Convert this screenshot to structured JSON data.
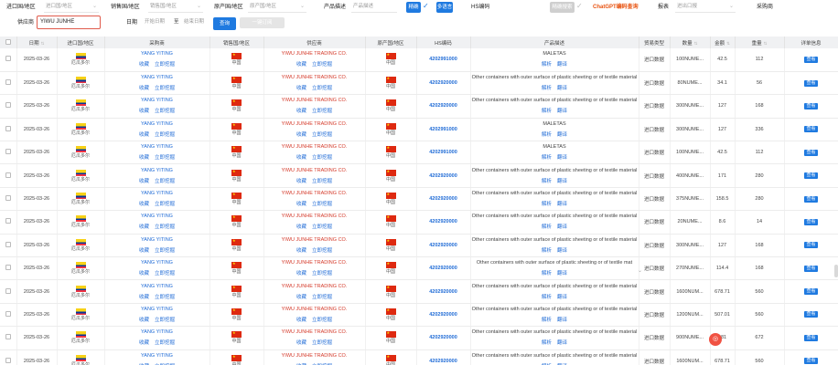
{
  "filters": {
    "import_country_label": "进口国/地区",
    "import_country_placeholder": "进口国/地区",
    "sales_country_label": "销售国/地区",
    "sales_country_placeholder": "销售国/地区",
    "origin_country_label": "原产国/地区",
    "origin_country_placeholder": "原产国/地区",
    "product_desc_label": "产品描述",
    "product_desc_placeholder": "产品描述",
    "exact_button": "精确",
    "multi_button": "多语言",
    "hs_label": "HS编码",
    "hs_action_button": "精确搜索",
    "chatgpt_button": "ChatGPT编码查询",
    "report_label": "报表",
    "report_placeholder": "进出口报",
    "buyer_label": "采购商",
    "supplier_label": "供应商",
    "supplier_value": "YIWU JUNHE",
    "date_label": "日期",
    "start_date_placeholder": "开始日期",
    "date_separator": "至",
    "end_date_placeholder": "结束日期",
    "search_button": "查询",
    "subscribe_button": "一键订阅"
  },
  "table": {
    "headers": {
      "date": "日期",
      "import_country": "进口国/地区",
      "buyer": "采购商",
      "sales_country": "销售国/地区",
      "supplier": "供应商",
      "origin_country": "原产国/地区",
      "hs": "HS编码",
      "desc": "产品描述",
      "trade_type": "贸易类型",
      "quantity": "数量",
      "amount": "金额",
      "weight": "重量",
      "detail": "详单信息"
    },
    "country_ec": "厄瓜多尔",
    "country_cn": "中国",
    "collect_label": "收藏",
    "tracking_label": "立即挖掘",
    "translate_a": "解析",
    "translate_b": "翻译",
    "view_label": "查看",
    "rows": [
      {
        "date": "2025-03-26",
        "buyer": "YANG YITING",
        "supplier": "YIWU JUNHE TRADING CO.",
        "hs": "4202991000",
        "desc": "MALETAS",
        "trade": "进口数据",
        "qty": "100NUME...",
        "amount": "42.5",
        "weight": "112"
      },
      {
        "date": "2025-03-26",
        "buyer": "YANG YITING",
        "supplier": "YIWU JUNHE TRADING CO.",
        "hs": "4202920000",
        "desc": "Other containers with outer surface of plastic sheeting or of textile material",
        "trade": "进口数据",
        "qty": "80NUME...",
        "amount": "34.1",
        "weight": "56"
      },
      {
        "date": "2025-03-26",
        "buyer": "YANG YITING",
        "supplier": "YIWU JUNHE TRADING CO.",
        "hs": "4202920000",
        "desc": "Other containers with outer surface of plastic sheeting or of textile material",
        "trade": "进口数据",
        "qty": "300NUME...",
        "amount": "127",
        "weight": "168"
      },
      {
        "date": "2025-03-26",
        "buyer": "YANG YITING",
        "supplier": "YIWU JUNHE TRADING CO.",
        "hs": "4202991000",
        "desc": "MALETAS",
        "trade": "进口数据",
        "qty": "300NUME...",
        "amount": "127",
        "weight": "336"
      },
      {
        "date": "2025-03-26",
        "buyer": "YANG YITING",
        "supplier": "YIWU JUNHE TRADING CO.",
        "hs": "4202991000",
        "desc": "MALETAS",
        "trade": "进口数据",
        "qty": "100NUME...",
        "amount": "42.5",
        "weight": "112"
      },
      {
        "date": "2025-03-26",
        "buyer": "YANG YITING",
        "supplier": "YIWU JUNHE TRADING CO.",
        "hs": "4202920000",
        "desc": "Other containers with outer surface of plastic sheeting or of textile material",
        "trade": "进口数据",
        "qty": "400NUME...",
        "amount": "171",
        "weight": "280"
      },
      {
        "date": "2025-03-26",
        "buyer": "YANG YITING",
        "supplier": "YIWU JUNHE TRADING CO.",
        "hs": "4202920000",
        "desc": "Other containers with outer surface of plastic sheeting or of textile material",
        "trade": "进口数据",
        "qty": "375NUME...",
        "amount": "158.5",
        "weight": "280"
      },
      {
        "date": "2025-03-26",
        "buyer": "YANG YITING",
        "supplier": "YIWU JUNHE TRADING CO.",
        "hs": "4202920000",
        "desc": "Other containers with outer surface of plastic sheeting or of textile material",
        "trade": "进口数据",
        "qty": "20NUME...",
        "amount": "8.6",
        "weight": "14"
      },
      {
        "date": "2025-03-26",
        "buyer": "YANG YITING",
        "supplier": "YIWU JUNHE TRADING CO.",
        "hs": "4202920000",
        "desc": "Other containers with outer surface of plastic sheeting or of textile material",
        "trade": "进口数据",
        "qty": "300NUME...",
        "amount": "127",
        "weight": "168"
      },
      {
        "date": "2025-03-26",
        "buyer": "YANG YITING",
        "supplier": "YIWU JUNHE TRADING CO.",
        "hs": "4202920000",
        "desc": "Other containers with outer surface of plastic sheeting or of textile mat",
        "trade": "进口数据",
        "qty": "270NUME...",
        "amount": "114.4",
        "weight": "168"
      },
      {
        "date": "2025-03-26",
        "buyer": "YANG YITING",
        "supplier": "YIWU JUNHE TRADING CO.",
        "hs": "4202920000",
        "desc": "Other containers with outer surface of plastic sheeting or of textile material",
        "trade": "进口数据",
        "qty": "1600NUM...",
        "amount": "678.71",
        "weight": "560"
      },
      {
        "date": "2025-03-26",
        "buyer": "YANG YITING",
        "supplier": "YIWU JUNHE TRADING CO.",
        "hs": "4202920000",
        "desc": "Other containers with outer surface of plastic sheeting or of textile material",
        "trade": "进口数据",
        "qty": "1200NUM...",
        "amount": "507.01",
        "weight": "560"
      },
      {
        "date": "2025-03-26",
        "buyer": "YANG YITING",
        "supplier": "YIWU JUNHE TRADING CO.",
        "hs": "4202920000",
        "desc": "Other containers with outer surface of plastic sheeting or of textile material",
        "trade": "进口数据",
        "qty": "900NUME...",
        "amount": "381",
        "weight": "672"
      },
      {
        "date": "2025-03-26",
        "buyer": "YANG YITING",
        "supplier": "YIWU JUNHE TRADING CO.",
        "hs": "4202920000",
        "desc": "Other containers with outer surface of plastic sheeting or of textile material",
        "trade": "进口数据",
        "qty": "1600NUM...",
        "amount": "678.71",
        "weight": "560"
      }
    ]
  },
  "colors": {
    "accent": "#1f7ae0",
    "supplier_red": "#d53a2a",
    "chatgpt_orange": "#e8520f"
  },
  "icons": {
    "float": "chat-bubble-icon"
  }
}
